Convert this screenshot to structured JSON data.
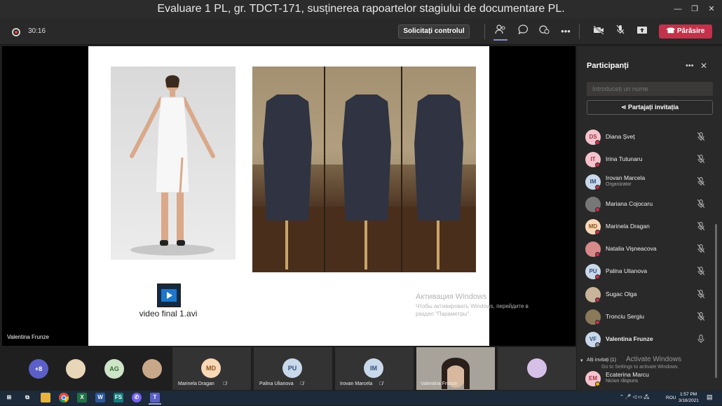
{
  "window": {
    "title": "Evaluare 1 PL, gr. TDCT-171, susținerea rapoartelor stagiului de documentare PL."
  },
  "toolbar": {
    "timer": "30:16",
    "request_control": "Solicitați controlul",
    "leave": "Părăsire"
  },
  "slide": {
    "video_file": "video final 1.avi",
    "watermark_title": "Активация Windows",
    "watermark_text": "Чтобы активировать Windows, перейдите в раздел \"Параметры\"."
  },
  "stage": {
    "speaker": "Valentina Frunze"
  },
  "panel": {
    "title": "Participanți",
    "search_placeholder": "Introduceți un nume",
    "share_label": "Partajați invitația",
    "participants": [
      {
        "initials": "DS",
        "name": "Diana Șveț",
        "color": "#f4c3cc",
        "text": "#a3364b"
      },
      {
        "initials": "IT",
        "name": "Irina Tutunaru",
        "color": "#f4c3cc",
        "text": "#a3364b"
      },
      {
        "initials": "IM",
        "name": "Irovan Marcela",
        "sub": "Organizator",
        "color": "#c9d8ea",
        "text": "#2f4f7a"
      },
      {
        "initials": "",
        "name": "Mariana Cojocaru",
        "color": "#777777",
        "text": "#fff"
      },
      {
        "initials": "MD",
        "name": "Marinela Dragan",
        "color": "#f7d8b7",
        "text": "#8a5422"
      },
      {
        "initials": "",
        "name": "Natalia Vișneacova",
        "color": "#d68a8a",
        "text": "#fff"
      },
      {
        "initials": "PU",
        "name": "Palina Ulianova",
        "color": "#c9d8ea",
        "text": "#2f4f7a"
      },
      {
        "initials": "",
        "name": "Sugac Olga",
        "color": "#c8b49a",
        "text": "#fff"
      },
      {
        "initials": "",
        "name": "Tronciu Sergiu",
        "color": "#8a7a5a",
        "text": "#fff"
      },
      {
        "initials": "VF",
        "name": "Valentina Frunze",
        "color": "#c9d8ea",
        "text": "#2f4f7a"
      }
    ],
    "others_label": "Alți invitați (1)",
    "others": [
      {
        "initials": "EM",
        "name": "Ecaterina Marcu",
        "sub": "Niciun răspuns",
        "color": "#f4c3cc",
        "text": "#a3364b"
      }
    ],
    "watermark_title": "Activate Windows",
    "watermark_text": "Go to Settings to activate Windows."
  },
  "bottom": {
    "overflow": "+8",
    "ag_initials": "AG",
    "tiles": [
      {
        "initials": "MD",
        "name": "Marinela Dragan"
      },
      {
        "initials": "PU",
        "name": "Palina Ulianova"
      },
      {
        "initials": "IM",
        "name": "Irovan Marcela"
      },
      {
        "initials": "",
        "name": "Valentina Frunze"
      }
    ]
  },
  "taskbar": {
    "time": "1:57 PM",
    "date": "3/16/2021",
    "lang": "ROU"
  }
}
